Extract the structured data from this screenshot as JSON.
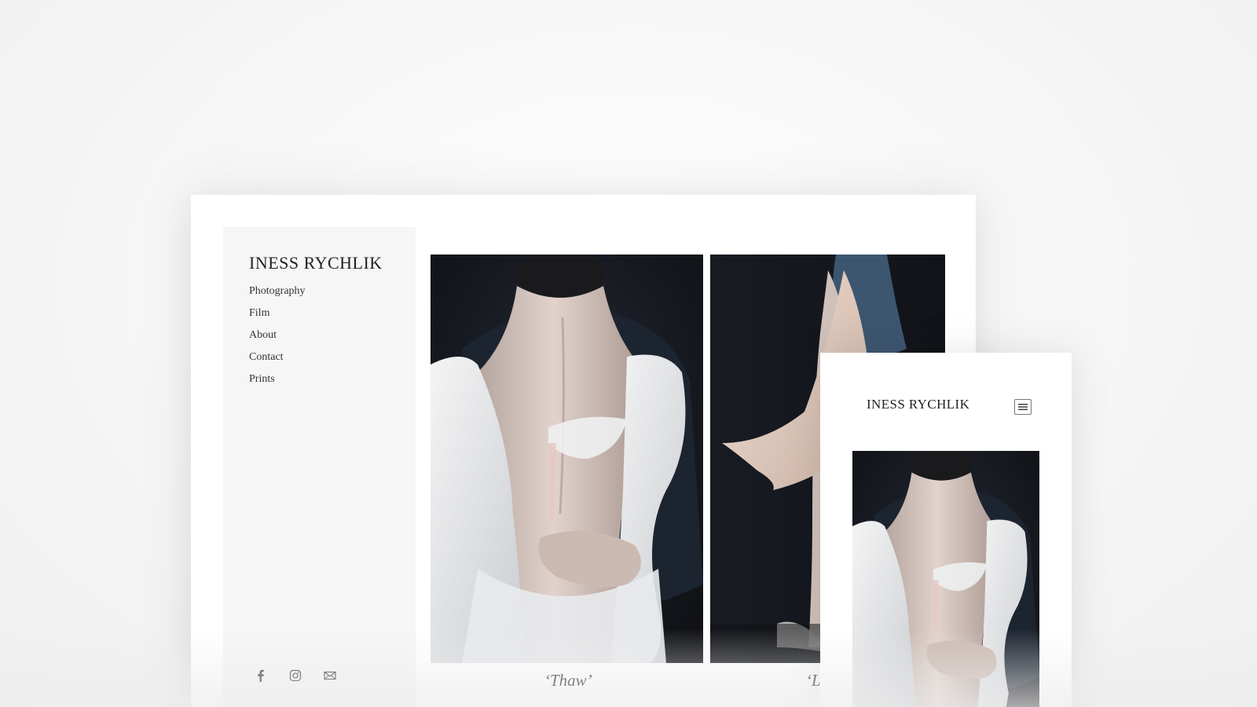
{
  "site": {
    "title": "INESS RYCHLIK"
  },
  "nav": {
    "items": [
      {
        "label": "Photography"
      },
      {
        "label": "Film"
      },
      {
        "label": "About"
      },
      {
        "label": "Contact"
      },
      {
        "label": "Prints"
      }
    ]
  },
  "social": {
    "icons": [
      "facebook-icon",
      "instagram-icon",
      "mail-icon"
    ]
  },
  "gallery": {
    "captions": [
      "‘Thaw’",
      "‘L"
    ]
  },
  "mobile": {
    "title": "INESS RYCHLIK",
    "menu_icon": "hamburger-menu-icon"
  },
  "colors": {
    "background": "#f5f5f5",
    "sidebar": "#f6f6f6",
    "photo_dark": "#15171c",
    "dress_blue": "#3d5670",
    "dress_lining": "#e6d2c6"
  }
}
